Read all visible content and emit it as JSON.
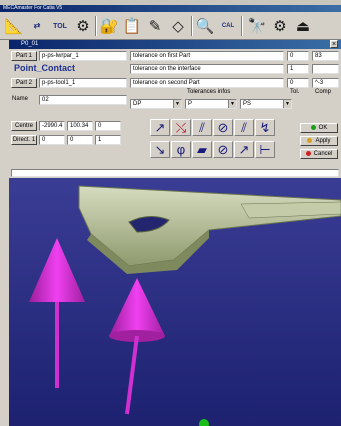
{
  "app": {
    "title": "MECAmaster For Catia V5",
    "tab_label": "P0_01"
  },
  "toolbar": {
    "icons": [
      "measure-icon",
      "tol-swap-icon",
      "tol-icon",
      "tools-icon",
      "lock-icon",
      "doc-icon",
      "edit-icon",
      "eraser-icon",
      "zoom-icon",
      "cal-icon",
      "binoculars-icon",
      "gear-icon",
      "export-icon"
    ],
    "tol_label": "TOL",
    "cal_label": "CAL"
  },
  "dialog": {
    "part1_button": "Part 1",
    "part1_value": "p-ps-lwrpar_1",
    "contact_label": "Point_Contact",
    "part2_button": "Part 2",
    "part2_value": "p-ps-tool1_1",
    "name_label": "Name",
    "name_value": "02",
    "tolerances": [
      {
        "label": "tolerance on first Part",
        "tol": "0",
        "comp": "83"
      },
      {
        "label": "tolerance on the interface",
        "tol": "1",
        "comp": ""
      },
      {
        "label": "tolerance on second Part",
        "tol": "0",
        "comp": "^-3"
      }
    ],
    "tol_infos_title": "Tolerances infos",
    "tol_col": "Tol.",
    "comp_col": "Comp",
    "combos": [
      "DP",
      "P",
      "PS"
    ],
    "centre_button": "Centre",
    "centre_values": [
      "-2990.4",
      "100.34",
      "0"
    ],
    "direct_button": "Direct. 1",
    "direct_values": [
      "0",
      "0",
      "1"
    ],
    "ok_label": "OK",
    "apply_label": "Apply",
    "cancel_label": "Cancel"
  },
  "status": {
    "text": ""
  },
  "colors": {
    "title_bar": "#0a246a",
    "dialog_bg": "#d4d0c8",
    "viewport_bg": "#2a2d7a",
    "arrow": "#d020d0",
    "part": "#b8c49a",
    "ok": "#18a018",
    "apply": "#d8a020",
    "cancel": "#d02020"
  }
}
